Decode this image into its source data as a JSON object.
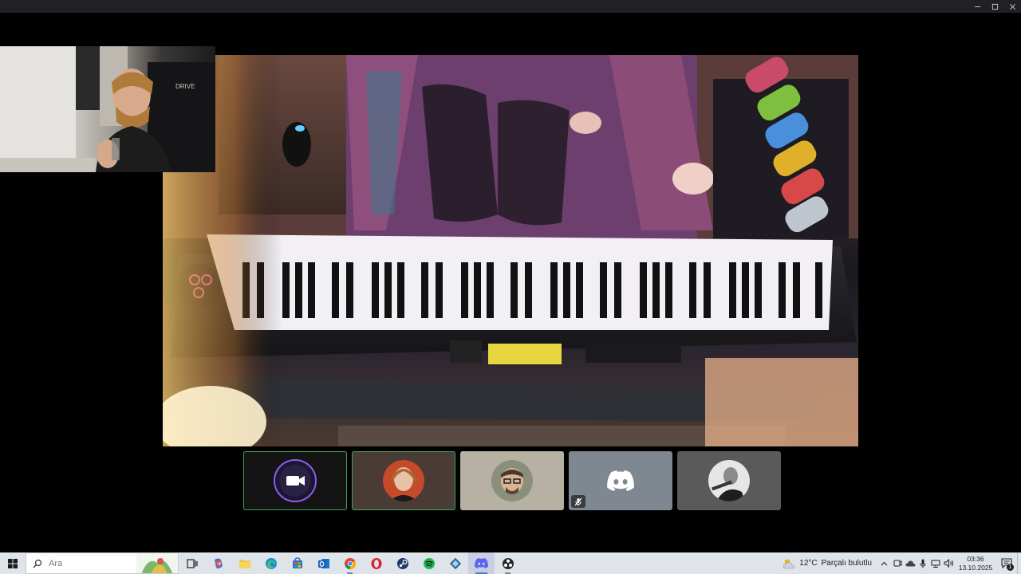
{
  "window": {
    "controls": [
      "minimize-icon",
      "maximize-icon",
      "close-icon"
    ]
  },
  "main_video": {
    "description_icon": "keyboard-stream"
  },
  "participants": [
    {
      "name": "camera-tile",
      "kind": "video-icon",
      "speaking": true,
      "bg": "#141414",
      "ring": "#8a5cf5"
    },
    {
      "name": "participant-2",
      "kind": "avatar",
      "speaking": true,
      "bg": "#4a3b36"
    },
    {
      "name": "participant-3",
      "kind": "avatar",
      "speaking": false,
      "bg": "#b7b1a4"
    },
    {
      "name": "participant-4",
      "kind": "discord-logo",
      "speaking": false,
      "muted": true,
      "bg": "#7f8891"
    },
    {
      "name": "participant-5",
      "kind": "avatar",
      "speaking": false,
      "bg": "#5a5a5a"
    }
  ],
  "taskbar": {
    "search_placeholder": "Ara",
    "apps": [
      {
        "name": "task-view",
        "icon": "task-view-icon"
      },
      {
        "name": "copilot",
        "icon": "copilot-icon"
      },
      {
        "name": "file-explorer",
        "icon": "folder-icon"
      },
      {
        "name": "edge",
        "icon": "edge-icon"
      },
      {
        "name": "store",
        "icon": "store-icon"
      },
      {
        "name": "outlook",
        "icon": "outlook-icon"
      },
      {
        "name": "chrome",
        "icon": "chrome-icon"
      },
      {
        "name": "opera",
        "icon": "opera-icon"
      },
      {
        "name": "steam",
        "icon": "steam-icon"
      },
      {
        "name": "spotify",
        "icon": "spotify-icon"
      },
      {
        "name": "app-blue",
        "icon": "diamond-app-icon"
      },
      {
        "name": "discord",
        "icon": "discord-icon"
      },
      {
        "name": "obs",
        "icon": "obs-icon"
      }
    ],
    "weather": {
      "temp": "12°C",
      "condition": "Parçalı bulutlu"
    },
    "clock": {
      "time": "03:36",
      "date": "13.10.2025"
    },
    "notification_count": "1"
  },
  "colors": {
    "taskbar_bg": "#dfe3ea",
    "speaking_outline": "#3ba55c",
    "discord_blurple": "#5865f2"
  }
}
